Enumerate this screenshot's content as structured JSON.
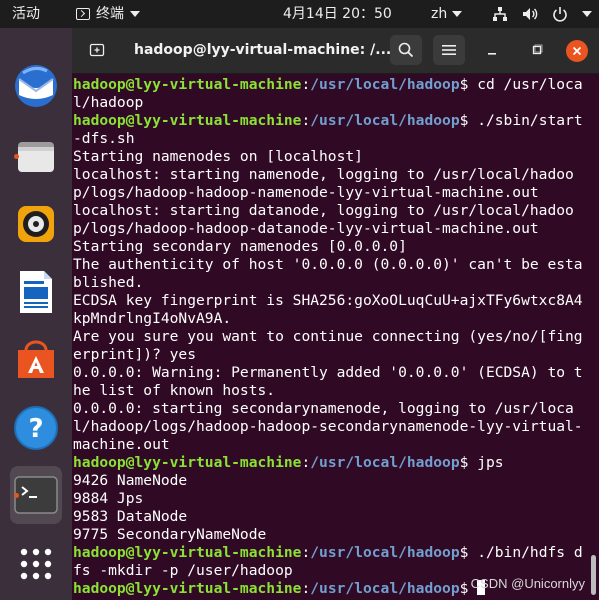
{
  "topbar": {
    "activities": "活动",
    "app_name": "终端",
    "clock": "4月14日  20：50",
    "ime": "zh",
    "icons": [
      "network-icon",
      "volume-icon",
      "power-icon"
    ]
  },
  "dock": {
    "items": [
      "thunderbird-icon",
      "files-icon",
      "rhythmbox-icon",
      "writer-icon",
      "software-icon",
      "help-icon",
      "terminal-icon",
      "app-grid-icon"
    ]
  },
  "window": {
    "title": "hadoop@lyy-virtual-machine: /..."
  },
  "terminal": {
    "lines": [
      {
        "type": "prompt",
        "user": "hadoop@lyy-virtual-machine",
        "path": "/usr/local/hadoop",
        "cmd": "$ cd /usr/local/hadoop"
      },
      {
        "type": "prompt",
        "user": "hadoop@lyy-virtual-machine",
        "path": "/usr/local/hadoop",
        "cmd": "$ ./sbin/start-dfs.sh"
      },
      {
        "type": "out",
        "text": "Starting namenodes on [localhost]"
      },
      {
        "type": "out",
        "text": "localhost: starting namenode, logging to /usr/local/hadoop/logs/hadoop-hadoop-namenode-lyy-virtual-machine.out"
      },
      {
        "type": "out",
        "text": "localhost: starting datanode, logging to /usr/local/hadoop/logs/hadoop-hadoop-datanode-lyy-virtual-machine.out"
      },
      {
        "type": "out",
        "text": "Starting secondary namenodes [0.0.0.0]"
      },
      {
        "type": "out",
        "text": "The authenticity of host '0.0.0.0 (0.0.0.0)' can't be established."
      },
      {
        "type": "out",
        "text": "ECDSA key fingerprint is SHA256:goXoOLuqCuU+ajxTFy6wtxc8A4kpMndrlngI4oNvA9A."
      },
      {
        "type": "out",
        "text": "Are you sure you want to continue connecting (yes/no/[fingerprint])? yes"
      },
      {
        "type": "out",
        "text": "0.0.0.0: Warning: Permanently added '0.0.0.0' (ECDSA) to the list of known hosts."
      },
      {
        "type": "out",
        "text": "0.0.0.0: starting secondarynamenode, logging to /usr/local/hadoop/logs/hadoop-hadoop-secondarynamenode-lyy-virtual-machine.out"
      },
      {
        "type": "prompt",
        "user": "hadoop@lyy-virtual-machine",
        "path": "/usr/local/hadoop",
        "cmd": "$ jps"
      },
      {
        "type": "out",
        "text": "9426 NameNode"
      },
      {
        "type": "out",
        "text": "9884 Jps"
      },
      {
        "type": "out",
        "text": "9583 DataNode"
      },
      {
        "type": "out",
        "text": "9775 SecondaryNameNode"
      },
      {
        "type": "prompt",
        "user": "hadoop@lyy-virtual-machine",
        "path": "/usr/local/hadoop",
        "cmd": "$ ./bin/hdfs dfs -mkdir -p /user/hadoop"
      },
      {
        "type": "prompt_cursor",
        "user": "hadoop@lyy-virtual-machine",
        "path": "/usr/local/hadoop",
        "cmd": "$ "
      }
    ]
  },
  "watermark": "CSDN @Unicornlyy",
  "colors": {
    "terminal_bg": "#300a24",
    "prompt_user": "#8ae234",
    "prompt_path": "#729fcf",
    "close_button": "#e95420"
  }
}
